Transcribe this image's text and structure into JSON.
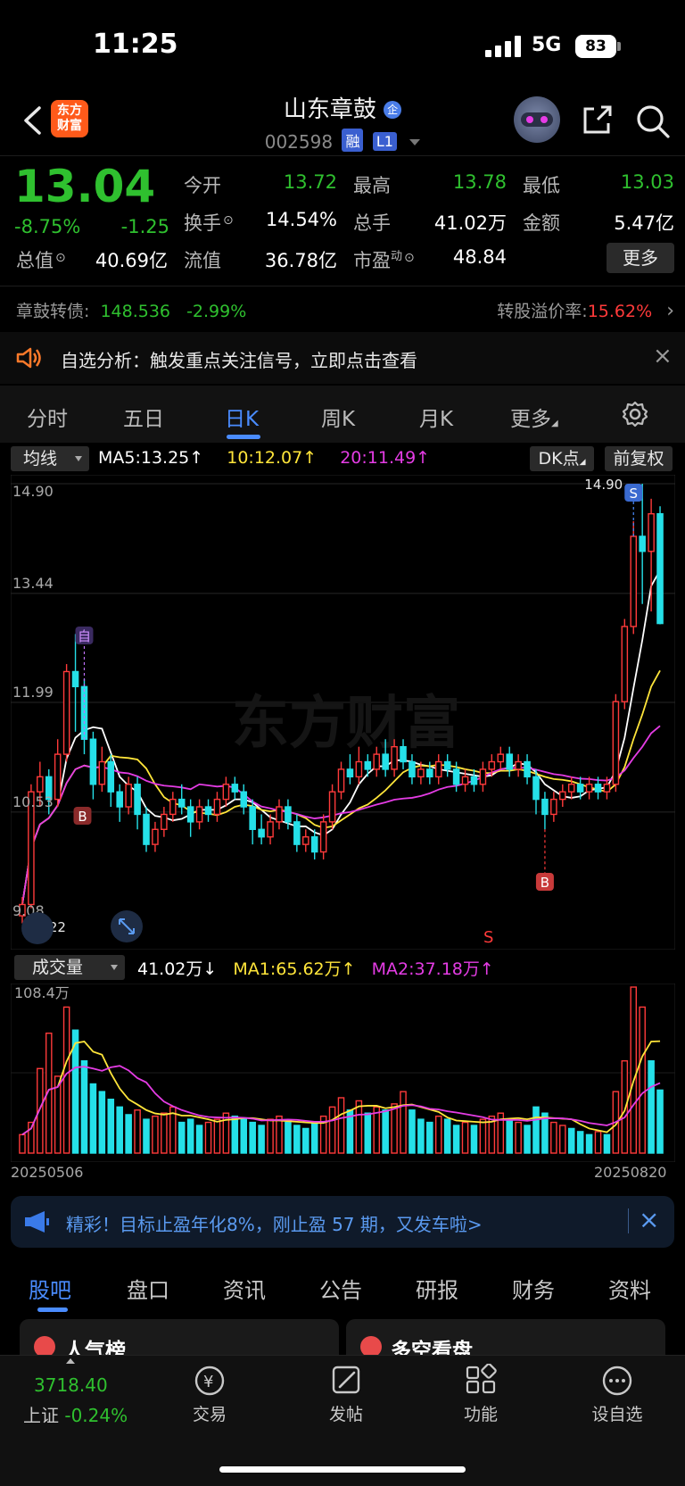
{
  "status": {
    "time": "11:25",
    "network": "5G",
    "battery": "83"
  },
  "header": {
    "logo_text": "东方\n财富",
    "stock_name": "山东章鼓",
    "stock_code": "002598",
    "tags": [
      "融",
      "L1"
    ]
  },
  "quote": {
    "price": "13.04",
    "change_pct": "-8.75%",
    "change": "-1.25",
    "open_label": "今开",
    "open": "13.72",
    "high_label": "最高",
    "high": "13.78",
    "low_label": "最低",
    "low": "13.03",
    "turnover_label": "换手",
    "turnover": "14.54%",
    "volume_label": "总手",
    "volume": "41.02万",
    "amount_label": "金额",
    "amount": "5.47亿",
    "mktcap_label": "总值",
    "mktcap": "40.69亿",
    "float_label": "流值",
    "float": "36.78亿",
    "pe_label": "市盈",
    "pe_sup": "动",
    "pe": "48.84",
    "more_label": "更多"
  },
  "bond": {
    "label": "章鼓转债:",
    "price": "148.536",
    "change": "-2.99%",
    "premium_label": "转股溢价率:",
    "premium": "15.62%"
  },
  "notice": {
    "text": "自选分析：触发重点关注信号，立即点击查看"
  },
  "kline_tabs": [
    "分时",
    "五日",
    "日K",
    "周K",
    "月K",
    "更多"
  ],
  "ma": {
    "select": "均线",
    "ma5": "MA5:13.25↑",
    "ma10": "10:12.07↑",
    "ma20": "20:11.49↑",
    "dk": "DK点",
    "fq": "前复权",
    "colors": {
      "ma5": "#ffffff",
      "ma10": "#ffe53a",
      "ma20": "#e43ce4"
    }
  },
  "kchart_labels": {
    "y_ticks": [
      "14.90",
      "13.44",
      "11.99",
      "10.53",
      "9.08"
    ],
    "low_mark": "9.22",
    "high_mark": "14.90",
    "watermark": "东方财富",
    "mark_self": "自",
    "mark_buy": "B",
    "mark_sell": "S"
  },
  "volume": {
    "select": "成交量",
    "vol": "41.02万↓",
    "ma1": "MA1:65.62万↑",
    "ma2": "MA2:37.18万↑",
    "max_label": "108.4万",
    "start_date": "20250506",
    "end_date": "20250820"
  },
  "chart_data": {
    "type": "candlestick",
    "ylim": [
      9.08,
      14.9
    ],
    "candles": [
      [
        9.15,
        9.3,
        9.05,
        9.4
      ],
      [
        9.3,
        10.8,
        9.25,
        10.9
      ],
      [
        10.8,
        11.0,
        10.6,
        11.2
      ],
      [
        11.0,
        10.7,
        10.5,
        11.1
      ],
      [
        10.7,
        11.3,
        10.6,
        11.5
      ],
      [
        11.3,
        12.4,
        11.2,
        12.5
      ],
      [
        12.4,
        12.2,
        11.6,
        12.9
      ],
      [
        12.2,
        11.5,
        11.3,
        12.3
      ],
      [
        11.5,
        10.9,
        10.7,
        11.6
      ],
      [
        10.9,
        11.2,
        10.8,
        11.4
      ],
      [
        11.2,
        10.8,
        10.6,
        11.3
      ],
      [
        10.8,
        10.6,
        10.4,
        10.9
      ],
      [
        10.6,
        10.9,
        10.5,
        11.0
      ],
      [
        10.9,
        10.5,
        10.3,
        11.0
      ],
      [
        10.5,
        10.1,
        10.0,
        10.6
      ],
      [
        10.1,
        10.3,
        10.0,
        10.4
      ],
      [
        10.3,
        10.5,
        10.2,
        10.6
      ],
      [
        10.5,
        10.7,
        10.4,
        10.8
      ],
      [
        10.7,
        10.6,
        10.5,
        10.9
      ],
      [
        10.6,
        10.4,
        10.2,
        10.7
      ],
      [
        10.4,
        10.6,
        10.3,
        10.7
      ],
      [
        10.6,
        10.5,
        10.4,
        10.7
      ],
      [
        10.5,
        10.7,
        10.4,
        10.8
      ],
      [
        10.7,
        10.9,
        10.6,
        11.0
      ],
      [
        10.9,
        10.8,
        10.7,
        11.0
      ],
      [
        10.8,
        10.6,
        10.5,
        10.9
      ],
      [
        10.6,
        10.3,
        10.1,
        10.7
      ],
      [
        10.3,
        10.2,
        10.1,
        10.5
      ],
      [
        10.2,
        10.4,
        10.1,
        10.5
      ],
      [
        10.4,
        10.6,
        10.3,
        10.7
      ],
      [
        10.6,
        10.4,
        10.3,
        10.7
      ],
      [
        10.4,
        10.1,
        10.0,
        10.5
      ],
      [
        10.1,
        10.2,
        10.0,
        10.3
      ],
      [
        10.2,
        10.0,
        9.9,
        10.3
      ],
      [
        10.0,
        10.4,
        9.9,
        10.5
      ],
      [
        10.4,
        10.8,
        10.3,
        10.9
      ],
      [
        10.8,
        11.1,
        10.7,
        11.2
      ],
      [
        11.1,
        11.0,
        10.9,
        11.3
      ],
      [
        11.0,
        11.2,
        10.9,
        11.4
      ],
      [
        11.2,
        11.1,
        11.0,
        11.3
      ],
      [
        11.1,
        11.3,
        11.0,
        11.4
      ],
      [
        11.3,
        11.1,
        11.0,
        11.5
      ],
      [
        11.1,
        11.4,
        11.0,
        11.5
      ],
      [
        11.4,
        11.2,
        11.1,
        11.5
      ],
      [
        11.2,
        11.0,
        10.9,
        11.3
      ],
      [
        11.0,
        11.1,
        10.9,
        11.2
      ],
      [
        11.1,
        11.0,
        10.9,
        11.2
      ],
      [
        11.0,
        11.2,
        10.9,
        11.3
      ],
      [
        11.2,
        11.1,
        11.0,
        11.3
      ],
      [
        11.1,
        10.9,
        10.8,
        11.2
      ],
      [
        10.9,
        11.0,
        10.8,
        11.1
      ],
      [
        11.0,
        10.9,
        10.8,
        11.1
      ],
      [
        10.9,
        11.1,
        10.8,
        11.2
      ],
      [
        11.1,
        11.2,
        11.0,
        11.3
      ],
      [
        11.2,
        11.3,
        11.1,
        11.4
      ],
      [
        11.3,
        11.1,
        11.0,
        11.4
      ],
      [
        11.1,
        11.2,
        11.0,
        11.3
      ],
      [
        11.2,
        11.0,
        10.9,
        11.3
      ],
      [
        11.0,
        10.7,
        10.5,
        11.1
      ],
      [
        10.7,
        10.5,
        10.3,
        10.8
      ],
      [
        10.5,
        10.7,
        10.4,
        10.8
      ],
      [
        10.7,
        10.8,
        10.6,
        10.9
      ],
      [
        10.8,
        10.9,
        10.7,
        11.0
      ],
      [
        10.9,
        10.8,
        10.7,
        11.0
      ],
      [
        10.8,
        10.9,
        10.7,
        11.0
      ],
      [
        10.9,
        10.8,
        10.7,
        11.0
      ],
      [
        10.8,
        10.9,
        10.7,
        11.0
      ],
      [
        10.9,
        12.0,
        10.8,
        12.1
      ],
      [
        12.0,
        13.0,
        11.9,
        13.1
      ],
      [
        13.0,
        14.2,
        12.9,
        14.4
      ],
      [
        14.2,
        14.0,
        13.3,
        14.9
      ],
      [
        14.0,
        14.5,
        13.2,
        14.7
      ],
      [
        14.5,
        13.04,
        13.03,
        14.6
      ]
    ],
    "volume": [
      [
        12,
        1
      ],
      [
        20,
        1
      ],
      [
        55,
        1
      ],
      [
        78,
        1
      ],
      [
        50,
        1
      ],
      [
        95,
        1
      ],
      [
        80,
        0
      ],
      [
        60,
        0
      ],
      [
        45,
        0
      ],
      [
        40,
        0
      ],
      [
        35,
        0
      ],
      [
        30,
        0
      ],
      [
        25,
        0
      ],
      [
        28,
        1
      ],
      [
        22,
        0
      ],
      [
        24,
        1
      ],
      [
        26,
        1
      ],
      [
        30,
        1
      ],
      [
        20,
        0
      ],
      [
        22,
        0
      ],
      [
        18,
        0
      ],
      [
        20,
        1
      ],
      [
        22,
        1
      ],
      [
        26,
        1
      ],
      [
        24,
        0
      ],
      [
        22,
        0
      ],
      [
        20,
        0
      ],
      [
        18,
        0
      ],
      [
        22,
        1
      ],
      [
        24,
        1
      ],
      [
        20,
        0
      ],
      [
        18,
        0
      ],
      [
        16,
        0
      ],
      [
        20,
        0
      ],
      [
        24,
        1
      ],
      [
        30,
        1
      ],
      [
        36,
        1
      ],
      [
        28,
        0
      ],
      [
        34,
        1
      ],
      [
        26,
        0
      ],
      [
        30,
        1
      ],
      [
        28,
        0
      ],
      [
        32,
        1
      ],
      [
        40,
        1
      ],
      [
        28,
        0
      ],
      [
        22,
        0
      ],
      [
        20,
        0
      ],
      [
        24,
        1
      ],
      [
        22,
        0
      ],
      [
        18,
        0
      ],
      [
        20,
        1
      ],
      [
        18,
        0
      ],
      [
        22,
        1
      ],
      [
        24,
        1
      ],
      [
        26,
        1
      ],
      [
        22,
        0
      ],
      [
        20,
        1
      ],
      [
        18,
        0
      ],
      [
        30,
        0
      ],
      [
        26,
        0
      ],
      [
        20,
        1
      ],
      [
        18,
        1
      ],
      [
        16,
        0
      ],
      [
        14,
        0
      ],
      [
        12,
        0
      ],
      [
        14,
        1
      ],
      [
        12,
        0
      ],
      [
        40,
        1
      ],
      [
        60,
        1
      ],
      [
        108,
        1
      ],
      [
        95,
        1
      ],
      [
        60,
        0
      ],
      [
        41,
        0
      ]
    ]
  },
  "ad": {
    "text": "精彩！目标止盈年化8%，刚止盈 57 期，又发车啦>"
  },
  "bottom_tabs": [
    "股吧",
    "盘口",
    "资讯",
    "公告",
    "研报",
    "财务",
    "资料"
  ],
  "cards": [
    "人气榜",
    "多空看盘"
  ],
  "bottom_nav": {
    "index_value": "3718.40",
    "index_name": "上证",
    "index_change": "-0.24%",
    "items": [
      "交易",
      "发帖",
      "功能",
      "设自选"
    ]
  }
}
